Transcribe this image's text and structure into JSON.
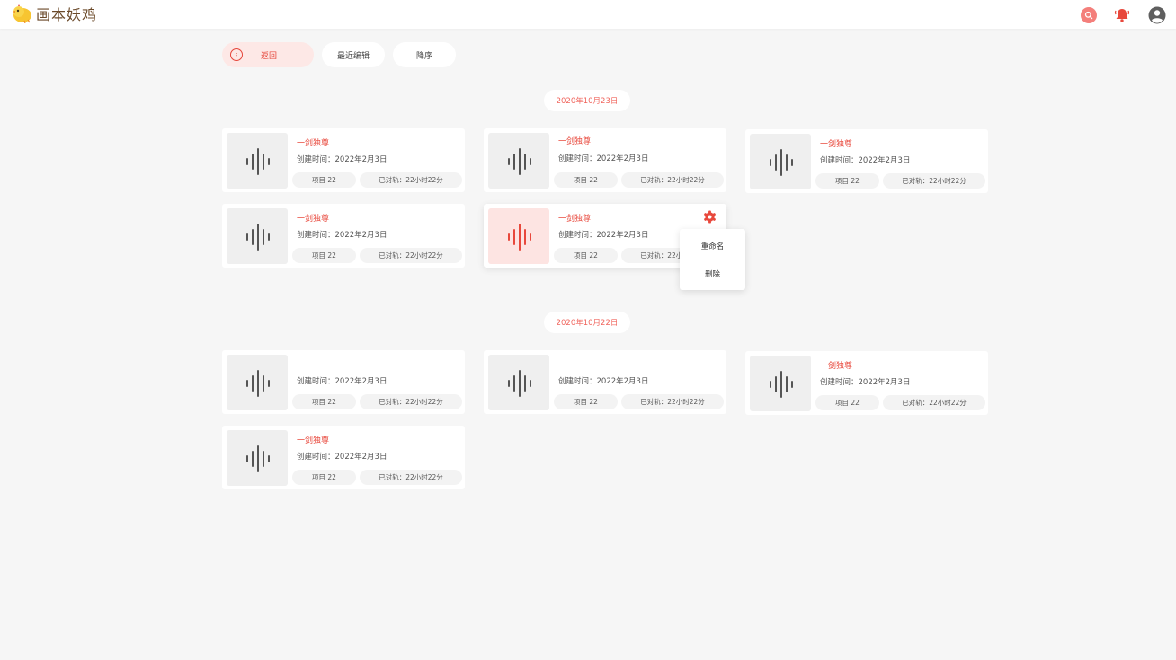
{
  "app": {
    "logo_text": "画本妖鸡",
    "accent_color": "#e8483c",
    "search_icon": "search-icon",
    "notification_icon": "bell-icon",
    "account_icon": "user-avatar-icon"
  },
  "toolbar": {
    "back_label": "返回",
    "recent_label": "最近编辑",
    "sort_label": "降序"
  },
  "groups": [
    {
      "date": "2020年10月23日",
      "cards": [
        {
          "title": "一剑独尊",
          "created": "创建时间：2022年2月3日",
          "items": "项目 22",
          "duration": "已对轨：22小时22分"
        },
        {
          "title": "一剑独尊",
          "created": "创建时间：2022年2月3日",
          "items": "项目 22",
          "duration": "已对轨：22小时22分"
        },
        {
          "title": "一剑独尊",
          "created": "创建时间：2022年2月3日",
          "items": "项目 22",
          "duration": "已对轨：22小时22分"
        },
        {
          "title": "一剑独尊",
          "created": "创建时间：2022年2月3日",
          "items": "项目 22",
          "duration": "已对轨：22小时22分"
        },
        {
          "title": "一剑独尊",
          "created": "创建时间：2022年2月3日",
          "items": "项目 22",
          "duration": "已对轨：22小时22分",
          "active": true
        }
      ]
    },
    {
      "date": "2020年10月22日",
      "cards": [
        {
          "title": "",
          "created": "创建时间：2022年2月3日",
          "items": "项目 22",
          "duration": "已对轨：22小时22分"
        },
        {
          "title": "",
          "created": "创建时间：2022年2月3日",
          "items": "项目 22",
          "duration": "已对轨：22小时22分"
        },
        {
          "title": "一剑独尊",
          "created": "创建时间：2022年2月3日",
          "items": "项目 22",
          "duration": "已对轨：22小时22分"
        },
        {
          "title": "一剑独尊",
          "created": "创建时间：2022年2月3日",
          "items": "项目 22",
          "duration": "已对轨：22小时22分"
        }
      ]
    }
  ],
  "context_menu": {
    "rename_label": "重命名",
    "delete_label": "删除"
  }
}
